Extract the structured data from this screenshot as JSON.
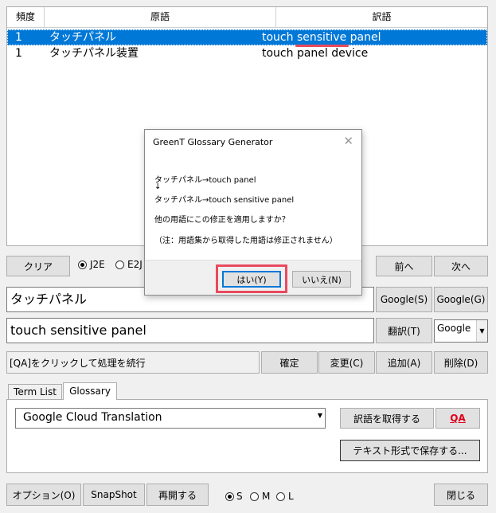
{
  "table": {
    "headers": [
      "頻度",
      "原語",
      "訳語"
    ],
    "rows": [
      {
        "freq": "1",
        "source": "タッチパネル",
        "target": "touch sensitive panel",
        "selected": true
      },
      {
        "freq": "1",
        "source": "タッチパネル装置",
        "target": "touch panel device",
        "selected": false
      }
    ]
  },
  "controls": {
    "clear": "クリア",
    "radio_j2e": "J2E",
    "radio_e2j": "E2J",
    "prev": "前へ",
    "next": "次へ"
  },
  "source_field": {
    "value": "タッチパネル"
  },
  "google_s": "Google(S)",
  "google_g": "Google(G)",
  "target_field": {
    "value": "touch sensitive panel"
  },
  "translate": "翻訳(T)",
  "engine_select": {
    "value": "Google"
  },
  "status": "[QA]をクリックして処理を続行",
  "confirm": "確定",
  "change": "変更(C)",
  "add": "追加(A)",
  "delete": "削除(D)",
  "tabs": [
    "Term List",
    "Glossary"
  ],
  "glossary": {
    "service": "Google Cloud Translation",
    "get_terms": "訳語を取得する",
    "qa": "QA",
    "save_text": "テキスト形式で保存する..."
  },
  "bottom": {
    "options": "オプション(O)",
    "snapshot": "SnapShot",
    "resume": "再開する",
    "size_s": "S",
    "size_m": "M",
    "size_l": "L",
    "close": "閉じる"
  },
  "dialog": {
    "title": "GreenT Glossary Generator",
    "line1": "タッチパネル→touch panel",
    "arrow": "↓",
    "line2": "タッチパネル→touch sensitive panel",
    "question": "他の用語にこの修正を適用しますか？",
    "note": "（注：用語集から取得した用語は修正されません）",
    "yes": "はい(Y)",
    "no": "いいえ(N)"
  },
  "colors": {
    "selection": "#0078d7",
    "highlight": "#e84a5f",
    "qa": "#e0001b"
  }
}
